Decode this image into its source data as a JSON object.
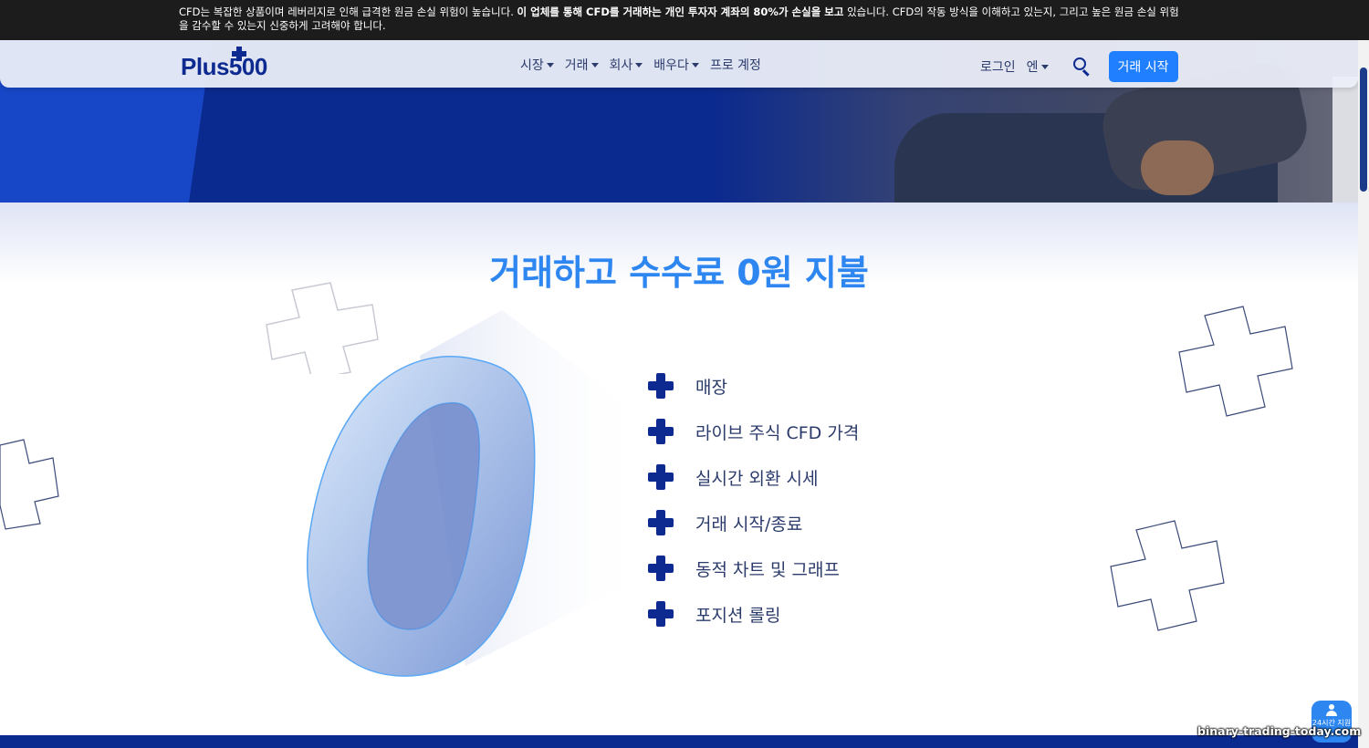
{
  "risk_warning": {
    "text_before": "CFD는 복잡한 상품이며 레버리지로 인해 급격한 원금 손실 위험이 높습니다. ",
    "bold": "이 업체를 통해 CFD를 거래하는 개인 투자자 계좌의 80%가 손실을 보고",
    "text_after": " 있습니다. CFD의 작동 방식을 이해하고 있는지, 그리고 높은 원금 손실 위험을 감수할 수 있는지 신중하게 고려해야 합니다."
  },
  "header": {
    "logo": "Plus500",
    "nav": [
      {
        "label": "시장"
      },
      {
        "label": "거래"
      },
      {
        "label": "회사"
      },
      {
        "label": "배우다"
      },
      {
        "label": "프로 계정"
      }
    ],
    "login_label": "로그인",
    "language_label": "엔",
    "start_button_label": "거래 시작"
  },
  "main": {
    "headline": "거래하고 수수료 0원 지불",
    "features": [
      {
        "label": "매장"
      },
      {
        "label": "라이브 주식 CFD 가격"
      },
      {
        "label": "실시간 외환 시세"
      },
      {
        "label": "거래 시작/종료"
      },
      {
        "label": "동적 차트 및 그래프"
      },
      {
        "label": "포지션 롤링"
      }
    ]
  },
  "chat": {
    "label": "24시간 지원"
  },
  "watermark": "binary-trading-today.com",
  "colors": {
    "brand_navy": "#0d2a91",
    "accent_blue": "#2e86f0",
    "button_blue": "#1f7fff",
    "risk_bar": "#1c1c1c"
  }
}
